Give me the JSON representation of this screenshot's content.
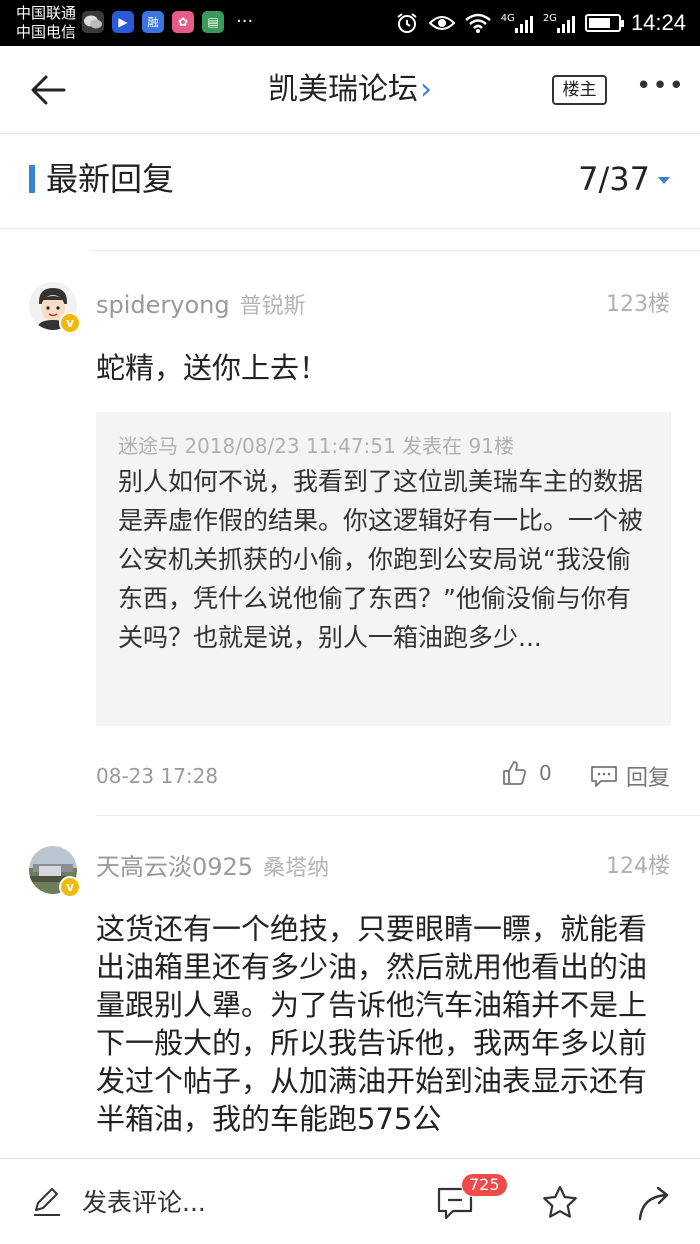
{
  "status_bar": {
    "carrier_1": "中国联通",
    "carrier_2": "中国电信",
    "time": "14:24",
    "net1": "4G",
    "net2": "2G",
    "battery_level_pct": 75
  },
  "header": {
    "title": "凯美瑞论坛",
    "owner_button": "楼主"
  },
  "section": {
    "title": "最新回复",
    "page_indicator": "7/37"
  },
  "posts": [
    {
      "username": "spideryong",
      "car_model": "普锐斯",
      "floor": "123楼",
      "content": "蛇精，送你上去！",
      "quote": {
        "meta": "迷途马 2018/08/23 11:47:51 发表在 91楼",
        "text": "别人如何不说，我看到了这位凯美瑞车主的数据是弄虚作假的结果。你这逻辑好有一比。一个被公安机关抓获的小偷，你跑到公安局说“我没偷东西，凭什么说他偷了东西？”他偷没偷与你有关吗？也就是说，别人一箱油跑多少..."
      },
      "time": "08-23 17:28",
      "likes": "0",
      "reply_label": "回复"
    },
    {
      "username": "天高云淡0925",
      "car_model": "桑塔纳",
      "floor": "124楼",
      "content": "这货还有一个绝技，只要眼睛一瞟，就能看出油箱里还有多少油，然后就用他看出的油量跟别人犟。为了告诉他汽车油箱并不是上下一般大的，所以我告诉他，我两年多以前发过个帖子，从加满油开始到油表显示还有半箱油，我的车能跑575公"
    }
  ],
  "bottom_bar": {
    "compose_placeholder": "发表评论...",
    "comment_count": "725"
  },
  "colors": {
    "accent": "#3b82d6",
    "badge_red": "#f04b4b",
    "vip_gold": "#f0b90b"
  },
  "icons": [
    "back-arrow-icon",
    "more-icon",
    "like-icon",
    "comment-icon",
    "pen-icon",
    "comments-icon",
    "star-icon",
    "share-icon"
  ]
}
